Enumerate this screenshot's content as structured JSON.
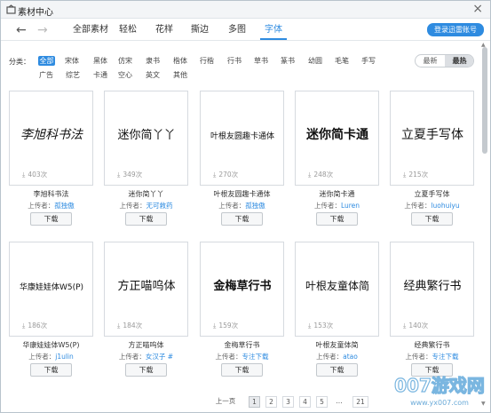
{
  "window": {
    "title": "素材中心",
    "close": "×"
  },
  "nav": {
    "back": "←",
    "forward": "→",
    "tabs": [
      "全部素材",
      "轻松",
      "花样",
      "撕边",
      "多图",
      "字体"
    ],
    "login": "登录迅雷账号"
  },
  "filters": {
    "label": "分类：",
    "row1": [
      "全部",
      "宋体",
      "黑体",
      "仿宋",
      "隶书",
      "楷体",
      "行楷",
      "行书",
      "草书",
      "篆书",
      "幼圆",
      "毛笔",
      "手写"
    ],
    "row2": [
      "广告",
      "综艺",
      "卡通",
      "空心",
      "英文",
      "其他"
    ]
  },
  "sort": {
    "latest": "最新",
    "hottest": "最热"
  },
  "cards": [
    {
      "preview": "李旭科书法",
      "downloads": "403次",
      "name": "李旭科书法",
      "uploader_label": "上传者：",
      "uploader": "孤独傲",
      "button": "下载"
    },
    {
      "preview": "迷你简丫丫",
      "downloads": "349次",
      "name": "迷你简丫丫",
      "uploader_label": "上传者：",
      "uploader": "无可救药",
      "button": "下载"
    },
    {
      "preview": "叶根友圆趣卡通体",
      "downloads": "270次",
      "name": "叶根友圆趣卡通体",
      "uploader_label": "上传者：",
      "uploader": "孤独傲",
      "button": "下载"
    },
    {
      "preview": "迷你简卡通",
      "downloads": "248次",
      "name": "迷你简卡通",
      "uploader_label": "上传者：",
      "uploader": "Luren",
      "button": "下载"
    },
    {
      "preview": "立夏手写体",
      "downloads": "215次",
      "name": "立夏手写体",
      "uploader_label": "上传者：",
      "uploader": "luohuiyu",
      "button": "下载"
    },
    {
      "preview": "华康娃娃体W5(P)",
      "downloads": "186次",
      "name": "华康娃娃体W5(P)",
      "uploader_label": "上传者：",
      "uploader": "j1ulin",
      "button": "下载"
    },
    {
      "preview": "方正喵呜体",
      "downloads": "184次",
      "name": "方正喵呜体",
      "uploader_label": "上传者：",
      "uploader": "女汉子 #",
      "button": "下载"
    },
    {
      "preview": "金梅草行书",
      "downloads": "159次",
      "name": "金梅草行书",
      "uploader_label": "上传者：",
      "uploader": "专注下载",
      "button": "下载"
    },
    {
      "preview": "叶根友童体简",
      "downloads": "153次",
      "name": "叶根友童体简",
      "uploader_label": "上传者：",
      "uploader": "atao",
      "button": "下载"
    },
    {
      "preview": "经典繁行书",
      "downloads": "140次",
      "name": "经典繁行书",
      "uploader_label": "上传者：",
      "uploader": "专注下载",
      "button": "下载"
    }
  ],
  "pager": {
    "prev": "上一页",
    "pages": [
      "1",
      "2",
      "3",
      "4",
      "5",
      "...",
      "21"
    ],
    "current": "1"
  },
  "watermark": {
    "brand": "007游戏网",
    "url": "www.yx007.com"
  }
}
